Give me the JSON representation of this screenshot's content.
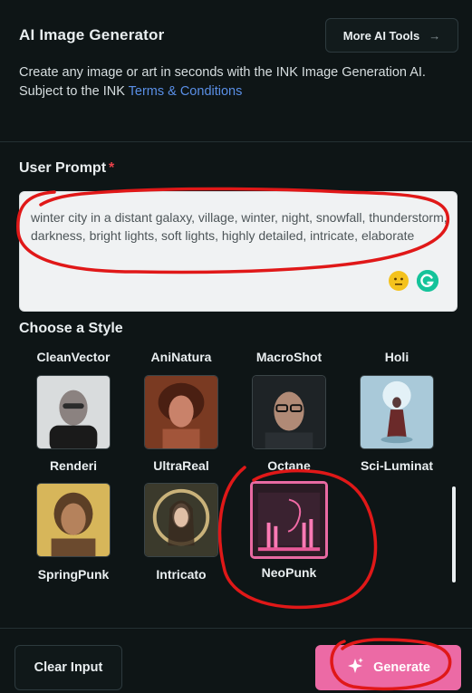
{
  "header": {
    "title": "AI Image Generator",
    "more_tools_label": "More AI Tools",
    "description_line1": "Create any image or art in seconds with the INK Image Generation AI.",
    "terms_prefix": "Subject to the INK ",
    "terms_link": "Terms & Conditions"
  },
  "prompt": {
    "label": "User Prompt",
    "required_marker": "*",
    "value": "winter city in a distant galaxy, village, winter, night, snowfall, thunderstorm, darkness, bright lights, soft lights, highly detailed, intricate, elaborate"
  },
  "styles": {
    "label": "Choose a Style",
    "row1_names": [
      "CleanVector",
      "AniNatura",
      "MacroShot",
      "Holi"
    ],
    "row2_names": [
      "Renderi",
      "UltraReal",
      "Octane",
      "Sci-Luminat"
    ],
    "row3_names": [
      "SpringPunk",
      "Intricato",
      "NeoPunk"
    ],
    "selected": "NeoPunk"
  },
  "footer": {
    "clear_label": "Clear Input",
    "generate_label": "Generate"
  },
  "colors": {
    "accent": "#ec6aa5",
    "link": "#5a8fe6",
    "required": "#e8414a",
    "annotation": "#e01818"
  }
}
